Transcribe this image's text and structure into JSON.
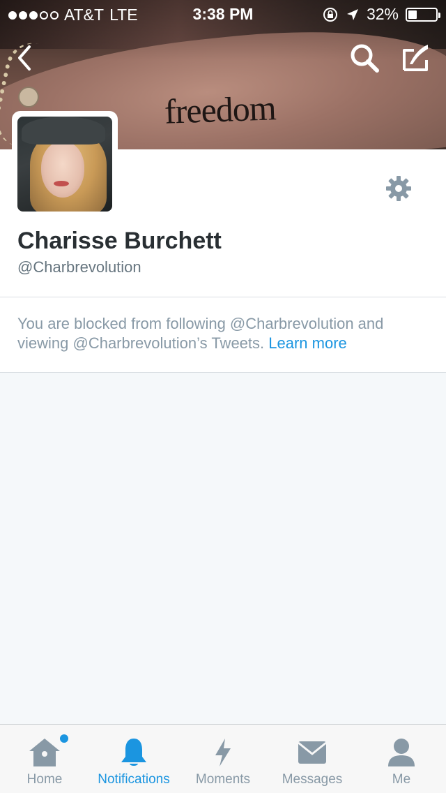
{
  "status_bar": {
    "carrier": "AT&T",
    "network": "LTE",
    "time": "3:38 PM",
    "battery": "32%",
    "battery_level": 0.32,
    "signal_bars_filled": 3,
    "signal_bars_total": 5
  },
  "header": {
    "banner_text": "freedom",
    "back_icon": "chevron-left-icon",
    "search_icon": "search-icon",
    "compose_icon": "compose-icon"
  },
  "profile": {
    "name": "Charisse Burchett",
    "handle": "@Charbrevolution",
    "settings_icon": "gear-icon"
  },
  "notice": {
    "text": "You are blocked from following @Charbrevolution and viewing @Charbrevolution’s Tweets.",
    "link": "Learn more"
  },
  "tabbar": {
    "items": [
      {
        "label": "Home",
        "icon": "home-icon",
        "active": false,
        "badge_dot": true
      },
      {
        "label": "Notifications",
        "icon": "bell-icon",
        "active": true,
        "badge_dot": false
      },
      {
        "label": "Moments",
        "icon": "lightning-icon",
        "active": false,
        "badge_dot": false
      },
      {
        "label": "Messages",
        "icon": "envelope-icon",
        "active": false,
        "badge_dot": false
      },
      {
        "label": "Me",
        "icon": "person-icon",
        "active": false,
        "badge_dot": false
      }
    ]
  },
  "colors": {
    "accent": "#1b95e0",
    "inactive": "#8899a6",
    "text": "#292f33",
    "background": "#f5f8fa"
  }
}
